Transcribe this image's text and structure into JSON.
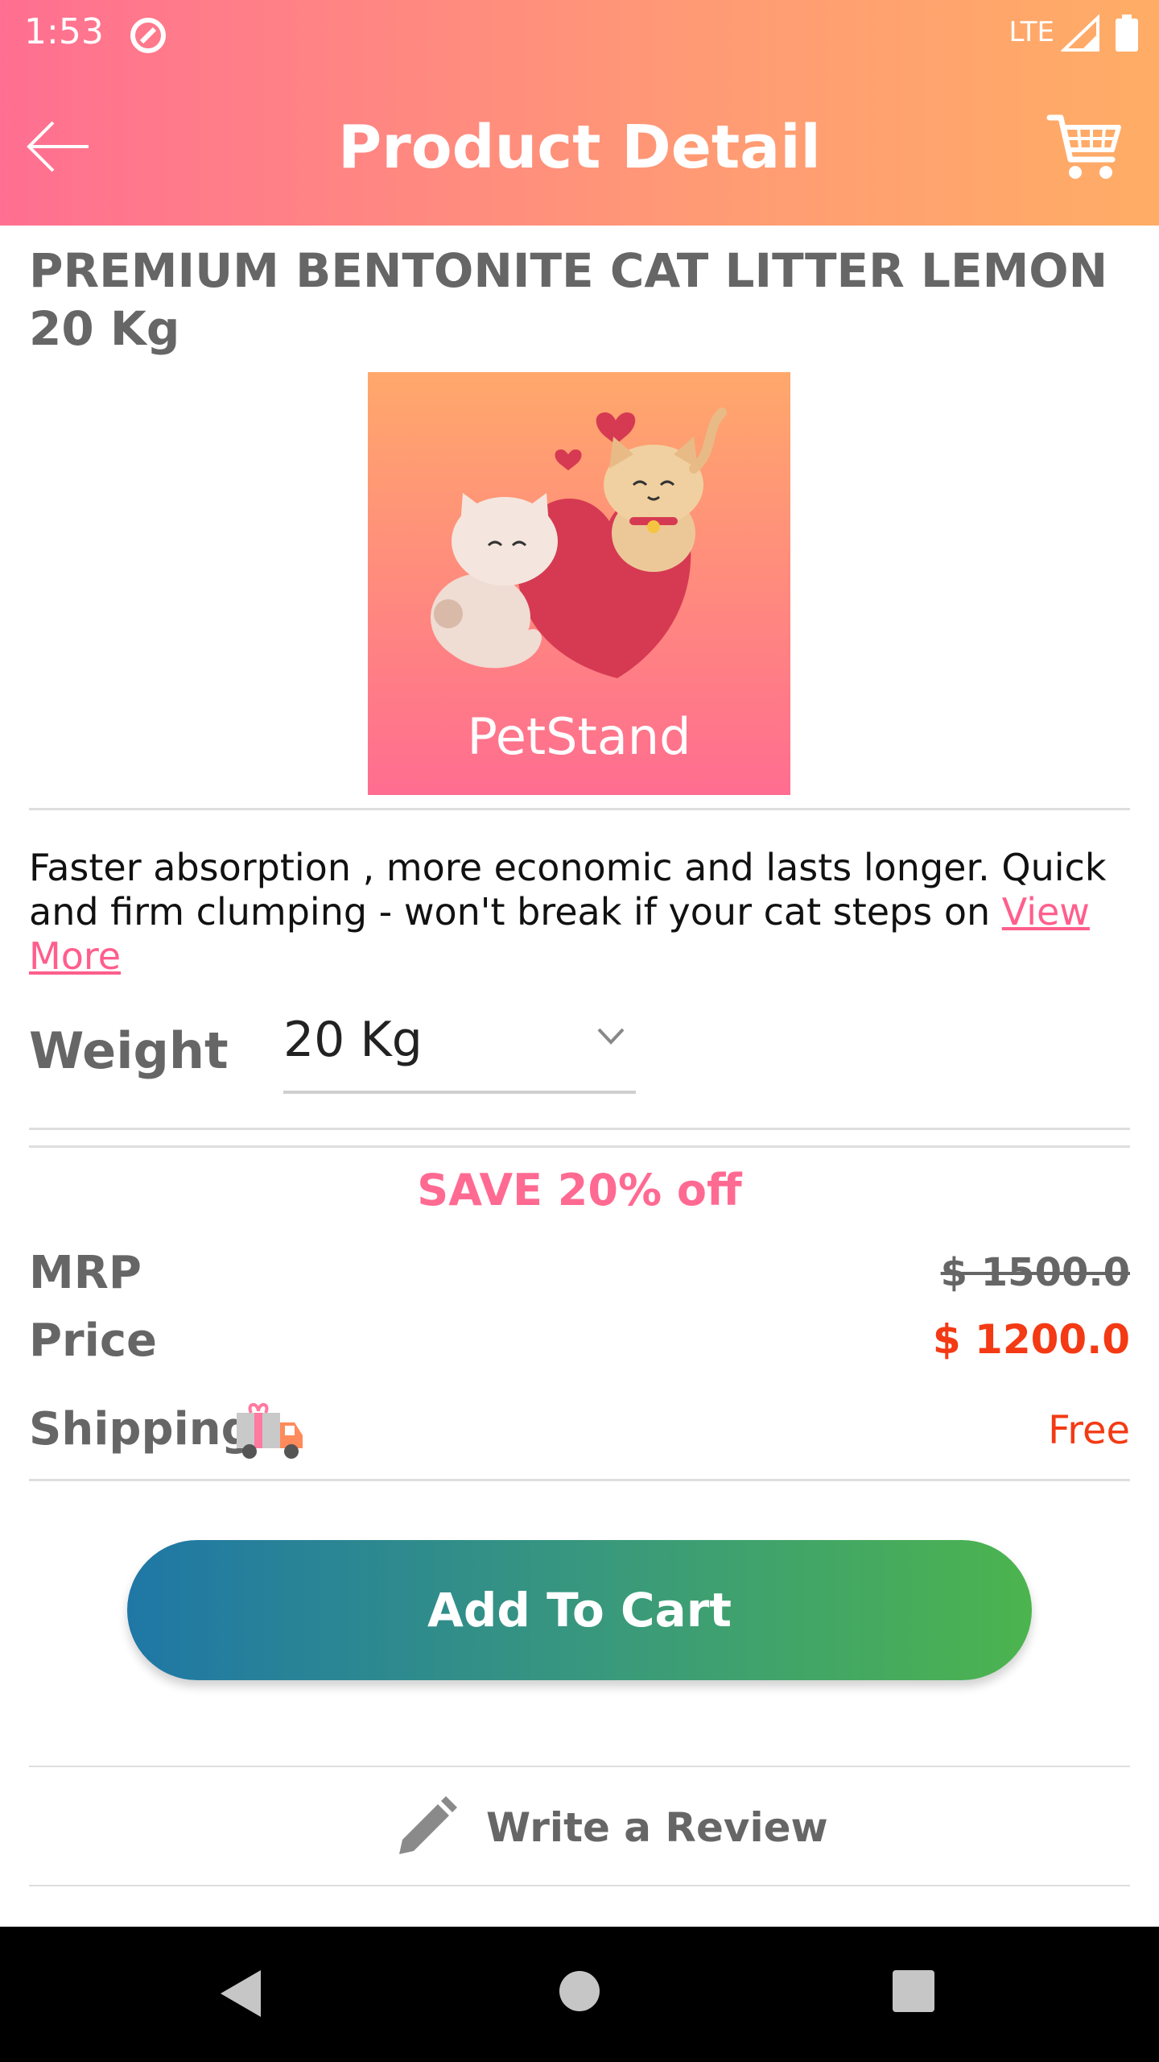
{
  "status_bar": {
    "time": "1:53",
    "network": "LTE"
  },
  "header": {
    "title": "Product Detail",
    "back_icon": "arrow-left-icon",
    "cart_icon": "shopping-cart-icon"
  },
  "product": {
    "title": "PREMIUM BENTONITE CAT LITTER LEMON 20 Kg",
    "brand": "PetStand",
    "description": "Faster absorption , more economic and lasts longer. Quick and firm clumping - won't break if your cat steps on",
    "view_more": "View More"
  },
  "weight": {
    "label": "Weight",
    "selected": "20 Kg"
  },
  "pricing": {
    "discount": "SAVE 20% off",
    "mrp_label": "MRP",
    "mrp": "$ 1500.0",
    "price_label": "Price",
    "price": "$ 1200.0",
    "shipping_label": "Shipping",
    "shipping": "Free"
  },
  "actions": {
    "add_to_cart": "Add To Cart",
    "write_review": "Write a Review"
  },
  "colors": {
    "header_start": "#ff6f91",
    "header_end": "#ffad66",
    "accent_pink": "#ff5e8d",
    "price_red": "#f33a14",
    "button_start": "#1f77a6",
    "button_end": "#4cb44e"
  }
}
